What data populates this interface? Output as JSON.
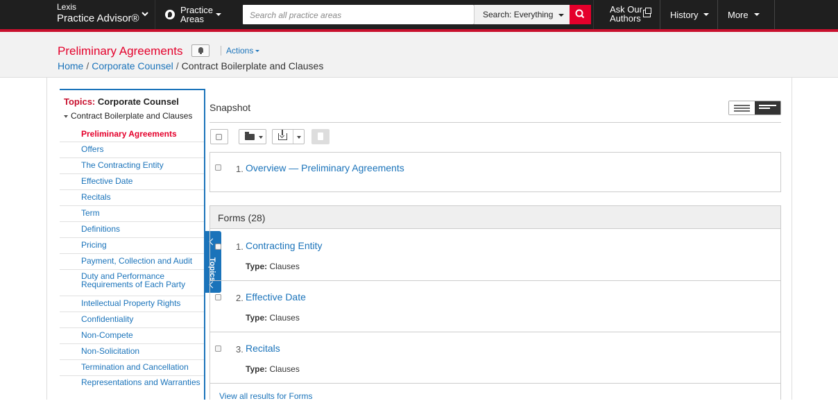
{
  "nav": {
    "brand_line1": "Lexis",
    "brand_line2": "Practice Advisor®",
    "practice_areas_line1": "Practice",
    "practice_areas_line2": "Areas",
    "search_placeholder": "Search all practice areas",
    "search_scope": "Search: Everything",
    "ask_line1": "Ask Our",
    "ask_line2": "Authors",
    "history": "History",
    "more": "More",
    "accent_color": "#e4002b",
    "bar_color": "#1f1f1f"
  },
  "header": {
    "title": "Preliminary Agreements",
    "actions": "Actions",
    "breadcrumb": [
      {
        "label": "Home"
      },
      {
        "label": "Corporate Counsel"
      },
      {
        "label": "Contract Boilerplate and Clauses"
      }
    ]
  },
  "sidebar": {
    "topics_label": "Topics:",
    "topics_value": "Corporate Counsel",
    "section": "Contract Boilerplate and Clauses",
    "items": [
      {
        "label": "Preliminary Agreements",
        "active": true
      },
      {
        "label": "Offers"
      },
      {
        "label": "The Contracting Entity"
      },
      {
        "label": "Effective Date"
      },
      {
        "label": "Recitals"
      },
      {
        "label": "Term"
      },
      {
        "label": "Definitions"
      },
      {
        "label": "Pricing"
      },
      {
        "label": "Payment, Collection and Audit"
      },
      {
        "label": "Duty and Performance Requirements of Each Party"
      },
      {
        "label": "Intellectual Property Rights"
      },
      {
        "label": "Confidentiality"
      },
      {
        "label": "Non-Compete"
      },
      {
        "label": "Non-Solicitation"
      },
      {
        "label": "Termination and Cancellation"
      },
      {
        "label": "Representations and Warranties"
      }
    ],
    "tab_label": "Topics"
  },
  "main": {
    "snapshot": "Snapshot",
    "overview": {
      "num": "1.",
      "title": "Overview — Preliminary Agreements"
    },
    "forms_header": "Forms (28)",
    "forms": [
      {
        "num": "1.",
        "title": "Contracting Entity",
        "type_label": "Type:",
        "type": "Clauses"
      },
      {
        "num": "2.",
        "title": "Effective Date",
        "type_label": "Type:",
        "type": "Clauses"
      },
      {
        "num": "3.",
        "title": "Recitals",
        "type_label": "Type:",
        "type": "Clauses"
      }
    ],
    "view_all": "View all results for Forms"
  }
}
